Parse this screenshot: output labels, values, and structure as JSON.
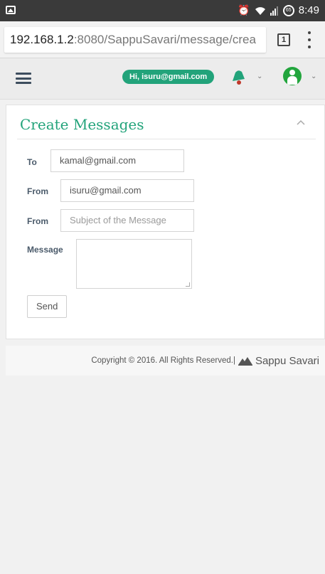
{
  "status_bar": {
    "time": "8:49",
    "battery": "65",
    "icons": [
      "image-icon",
      "alarm-icon",
      "wifi-icon",
      "signal-icon",
      "battery-icon"
    ]
  },
  "browser": {
    "url_host": "192.168.1.2",
    "url_rest": ":8080/SappuSavari/message/crea",
    "tab_count": "1"
  },
  "header": {
    "greeting": "Hi, isuru@gmail.com",
    "icons": [
      "menu-icon",
      "bell-icon",
      "user-icon"
    ],
    "accent_color": "#22a37a"
  },
  "card": {
    "title": "Create Messages",
    "fields": {
      "to_label": "To",
      "to_value": "kamal@gmail.com",
      "from_label": "From",
      "from_value": "isuru@gmail.com",
      "subject_label": "From",
      "subject_placeholder": "Subject of the Message",
      "message_label": "Message",
      "message_value": ""
    },
    "send_label": "Send"
  },
  "footer": {
    "copyright": "Copyright © 2016. All Rights Reserved.|",
    "brand": "Sappu Savari"
  }
}
